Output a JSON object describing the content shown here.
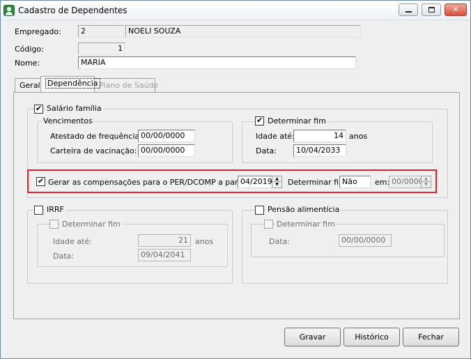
{
  "window": {
    "title": "Cadastro de Dependentes",
    "minimize_glyph": "",
    "maximize_glyph": "",
    "close_glyph": "✕"
  },
  "header": {
    "empregado_label": "Empregado:",
    "empregado_code": "2",
    "empregado_name": "NOELI SOUZA",
    "codigo_label": "Código:",
    "codigo_value": "1",
    "nome_label": "Nome:",
    "nome_value": "MARIA"
  },
  "tabs": [
    {
      "label": "Geral"
    },
    {
      "label": "Dependência"
    },
    {
      "label": "Plano de Saúde"
    }
  ],
  "salario_familia": {
    "label": "Salário família",
    "vencimentos": {
      "title": "Vencimentos",
      "atestado_label": "Atestado de frequência:",
      "atestado_value": "00/00/0000",
      "carteira_label": "Carteira de vacinação:",
      "carteira_value": "00/00/0000"
    },
    "determinar_fim": {
      "label": "Determinar fim",
      "idade_label": "Idade até:",
      "idade_value": "14",
      "idade_unit": "anos",
      "data_label": "Data:",
      "data_value": "10/04/2033"
    }
  },
  "compensacoes": {
    "label": "Gerar as compensações para o PER/DCOMP a partir de:",
    "date_value": "04/2019",
    "determinar_fim_label": "Determinar fim:",
    "determinar_fim_value": "Não",
    "em_label": "em:",
    "em_value": "00/0000"
  },
  "irrf": {
    "label": "IRRF",
    "determinar_fim_label": "Determinar fim",
    "idade_label": "Idade até:",
    "idade_value": "21",
    "idade_unit": "anos",
    "data_label": "Data:",
    "data_value": "09/04/2041"
  },
  "pensao": {
    "label": "Pensão alimentícia",
    "determinar_fim_label": "Determinar fim",
    "data_label": "Data:",
    "data_value": "00/00/0000"
  },
  "buttons": {
    "gravar": "Gravar",
    "historico": "Histórico",
    "fechar": "Fechar"
  },
  "spin_glyphs": {
    "up": "▲",
    "down": "▼"
  },
  "colors": {
    "highlight": "#e0202a",
    "close_button": "#d5523c",
    "app_icon": "#2e8b3e"
  }
}
